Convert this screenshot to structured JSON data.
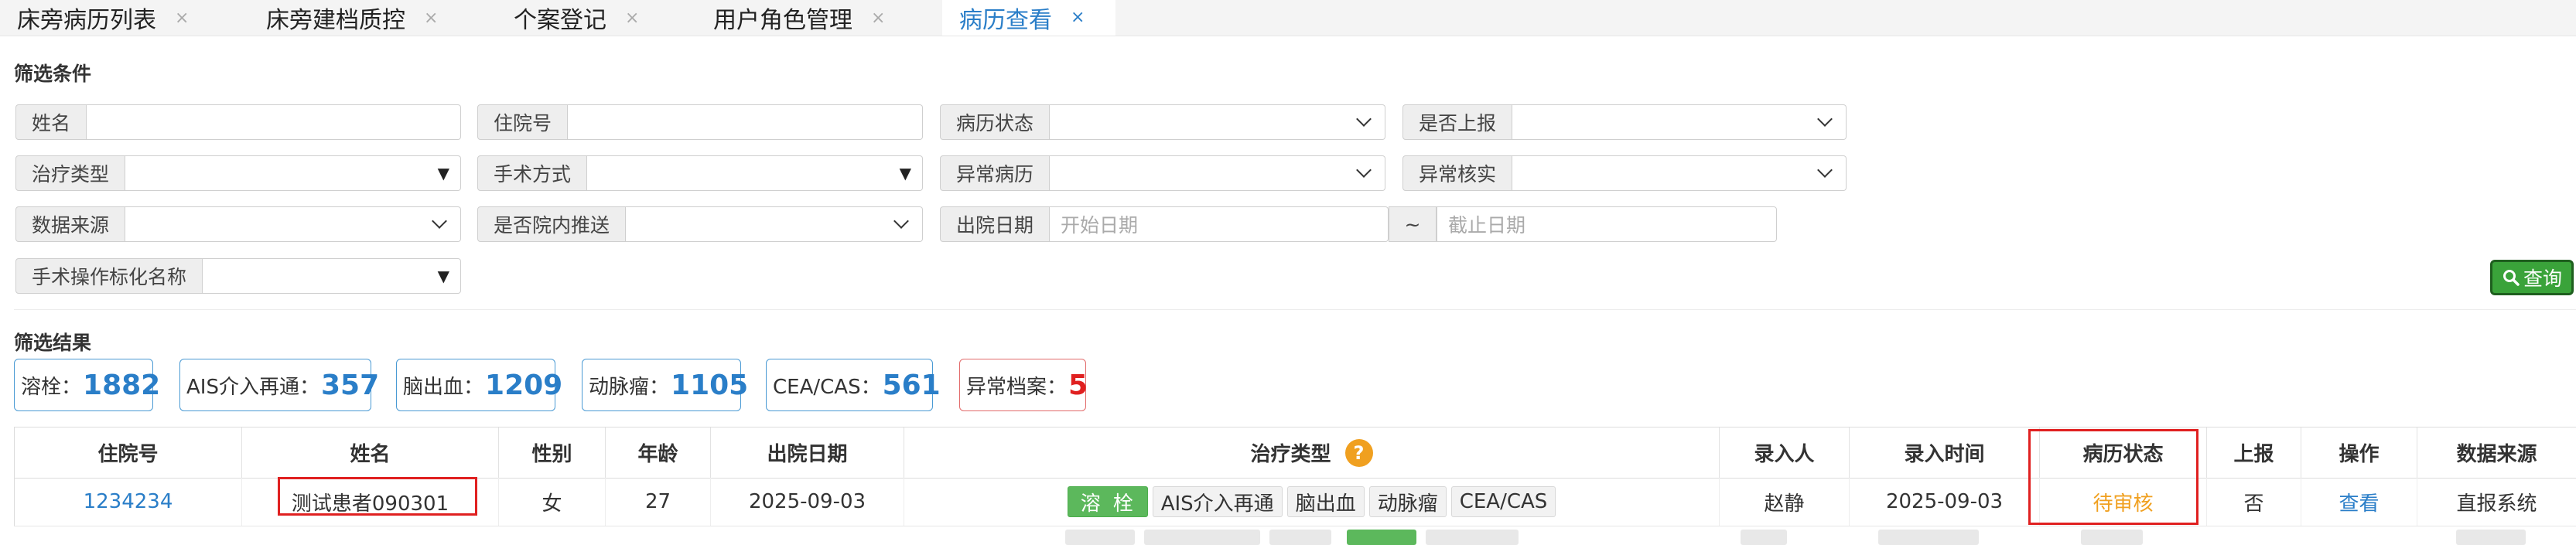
{
  "tabs": [
    {
      "label": "床旁病历列表",
      "close": "×"
    },
    {
      "label": "床旁建档质控",
      "close": "×"
    },
    {
      "label": "个案登记",
      "close": "×"
    },
    {
      "label": "用户角色管理",
      "close": "×"
    },
    {
      "label": "病历查看",
      "close": "×"
    }
  ],
  "filters": {
    "title": "筛选条件",
    "fields": {
      "name": {
        "label": "姓名",
        "value": ""
      },
      "admission_no": {
        "label": "住院号",
        "value": ""
      },
      "record_status": {
        "label": "病历状态",
        "value": ""
      },
      "reported": {
        "label": "是否上报",
        "value": ""
      },
      "treatment_type": {
        "label": "治疗类型",
        "value": ""
      },
      "surgery_method": {
        "label": "手术方式",
        "value": ""
      },
      "abnormal_record": {
        "label": "异常病历",
        "value": ""
      },
      "abnormal_verify": {
        "label": "异常核实",
        "value": ""
      },
      "data_source": {
        "label": "数据来源",
        "value": ""
      },
      "in_hospital_push": {
        "label": "是否院内推送",
        "value": ""
      },
      "discharge_date": {
        "label": "出院日期",
        "start_placeholder": "开始日期",
        "separator": "~",
        "end_placeholder": "截止日期"
      },
      "surgery_name": {
        "label": "手术操作标化名称",
        "value": ""
      }
    },
    "search_label": "查询"
  },
  "results": {
    "title": "筛选结果",
    "stats": [
      {
        "label": "溶栓：",
        "value": "1882"
      },
      {
        "label": "AIS介入再通：",
        "value": "357"
      },
      {
        "label": "脑出血：",
        "value": "1209"
      },
      {
        "label": "动脉瘤：",
        "value": "1105"
      },
      {
        "label": "CEA/CAS：",
        "value": "561"
      },
      {
        "label": "异常档案：",
        "value": "5"
      }
    ]
  },
  "table": {
    "columns": [
      "住院号",
      "姓名",
      "性别",
      "年龄",
      "出院日期",
      "治疗类型",
      "录入人",
      "录入时间",
      "病历状态",
      "上报",
      "操作",
      "数据来源"
    ],
    "help_icon": "?",
    "rows": [
      {
        "admission_no": "1234234",
        "name": "测试患者090301",
        "gender": "女",
        "age": "27",
        "discharge_date": "2025-09-03",
        "treatments": [
          "溶栓",
          "AIS介入再通",
          "脑出血",
          "动脉瘤",
          "CEA/CAS"
        ],
        "entered_by": "赵静",
        "entered_at": "2025-09-03",
        "status": "待审核",
        "reported": "否",
        "action": "查看",
        "source": "直报系统"
      }
    ]
  },
  "colors": {
    "accent": "#2a7ec8",
    "green": "#5cb85c",
    "danger": "#e02020",
    "pending": "#f0a020"
  }
}
